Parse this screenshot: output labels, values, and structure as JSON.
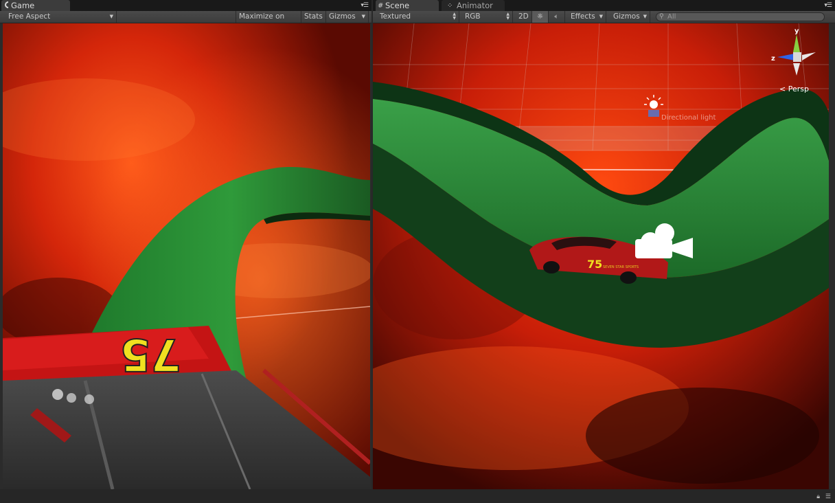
{
  "game": {
    "tab_label": "Game",
    "tab_icon": "game-controller-icon",
    "aspect_label": "Free Aspect",
    "maximize_label": "Maximize on Play",
    "stats_label": "Stats",
    "gizmos_label": "Gizmos",
    "car_number": "75"
  },
  "scene": {
    "tab_label": "Scene",
    "tab_icon": "grid-icon",
    "animator_tab_label": "Animator",
    "animator_icon": "animator-icon",
    "render_mode": "Textured",
    "color_mode": "RGB",
    "mode_2d_label": "2D",
    "lighting_icon": "sun-icon",
    "audio_icon": "speaker-icon",
    "effects_label": "Effects",
    "gizmos_label": "Gizmos",
    "search_placeholder": "All",
    "gizmo_y": "y",
    "gizmo_z": "z",
    "projection_label": "< Persp",
    "light_label": "Directional light",
    "car_number": "75",
    "car_sponsor": "SEVEN STAR SPORTS"
  },
  "colors": {
    "space_red": "#d62a0a",
    "track_green": "#2f8a3a",
    "panel_bg": "#2b2b2b",
    "toolbar": "#3f3f3f"
  },
  "statusbar": {
    "lock_icon": "lock-icon",
    "menu_icon": "menu-icon"
  }
}
